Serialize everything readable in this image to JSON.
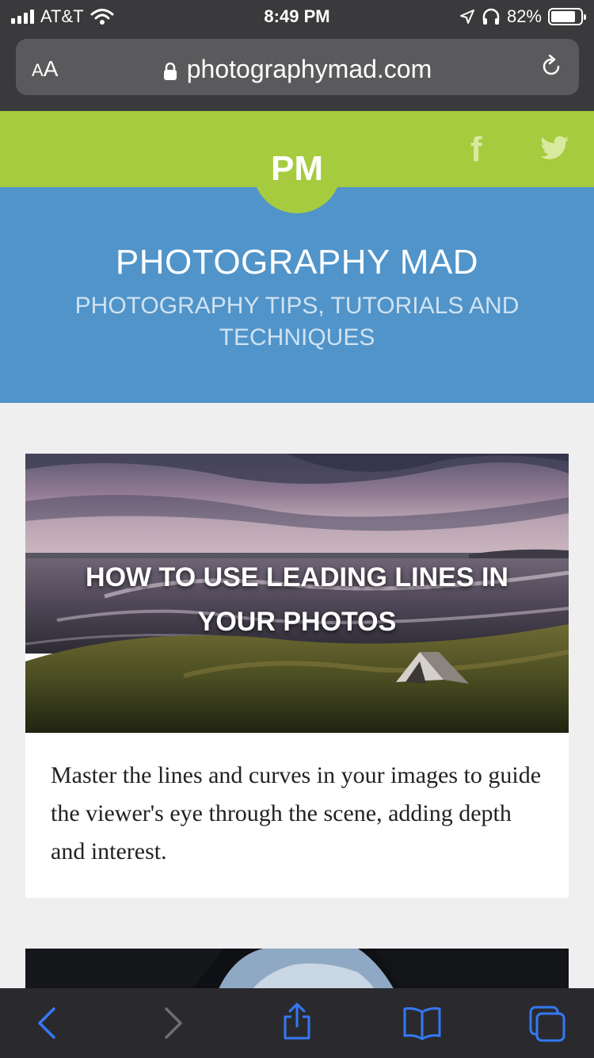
{
  "status": {
    "carrier": "AT&T",
    "time": "8:49 PM",
    "battery": "82%",
    "battery_level": 0.82
  },
  "browser": {
    "text_size_label": "AA",
    "url": "photographymad.com",
    "icons": [
      "lock-icon",
      "reload-icon"
    ]
  },
  "site": {
    "logo": "PM",
    "title": "PHOTOGRAPHY MAD",
    "tagline": "PHOTOGRAPHY TIPS, TUTORIALS AND TECHNIQUES",
    "social_icons": [
      "facebook-icon",
      "twitter-icon"
    ]
  },
  "articles": [
    {
      "title": "HOW TO USE LEADING LINES IN YOUR PHOTOS",
      "excerpt": "Master the lines and curves in your images to guide the viewer's eye through the scene, adding depth and interest."
    }
  ],
  "toolbar": {
    "icons": [
      "back-icon",
      "forward-icon",
      "share-icon",
      "bookmarks-icon",
      "tabs-icon"
    ]
  },
  "colors": {
    "green": "#a6cb3e",
    "blue": "#5094c9",
    "ios_blue": "#3478f6"
  }
}
